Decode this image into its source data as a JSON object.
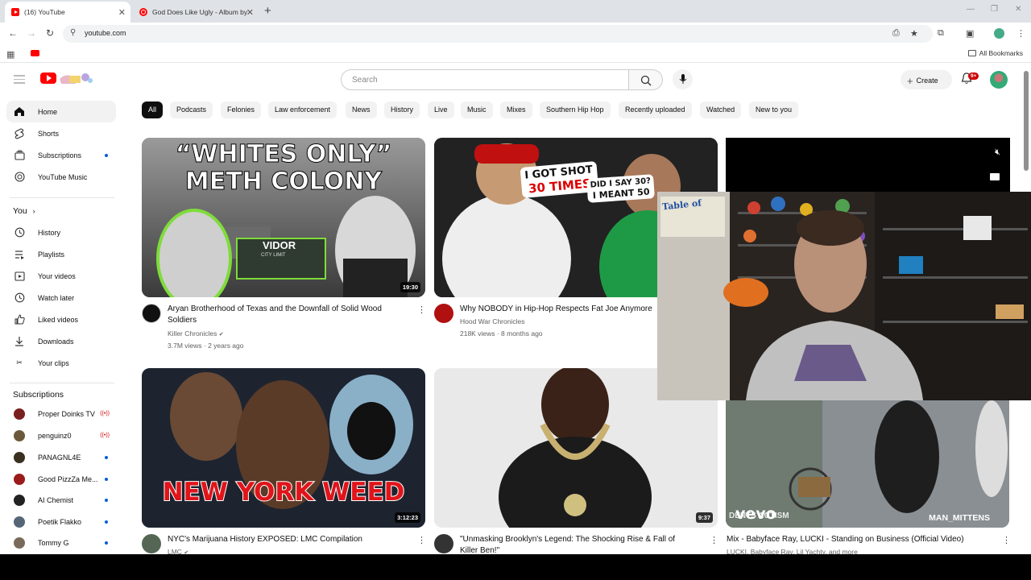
{
  "browser": {
    "tabs": [
      {
        "title": "(16) YouTube",
        "active": true
      },
      {
        "title": "God Does Like Ugly - Album by",
        "active": false
      }
    ],
    "url": "youtube.com",
    "all_bookmarks": "All Bookmarks"
  },
  "masthead": {
    "search_placeholder": "Search",
    "create_label": "Create",
    "notification_count": "9+"
  },
  "sidebar": {
    "main": [
      {
        "label": "Home",
        "icon": "home-icon",
        "active": true
      },
      {
        "label": "Shorts",
        "icon": "shorts-icon"
      },
      {
        "label": "Subscriptions",
        "icon": "subscriptions-icon",
        "dot": true
      },
      {
        "label": "YouTube Music",
        "icon": "music-icon"
      }
    ],
    "you_title": "You",
    "you": [
      {
        "label": "History",
        "icon": "history-icon"
      },
      {
        "label": "Playlists",
        "icon": "playlists-icon"
      },
      {
        "label": "Your videos",
        "icon": "your-videos-icon"
      },
      {
        "label": "Watch later",
        "icon": "watch-later-icon"
      },
      {
        "label": "Liked videos",
        "icon": "like-icon"
      },
      {
        "label": "Downloads",
        "icon": "download-icon"
      },
      {
        "label": "Your clips",
        "icon": "scissors-icon"
      }
    ],
    "subs_title": "Subscriptions",
    "subscriptions": [
      {
        "label": "Proper Doinks TV",
        "status": "live",
        "color": "#7a1f1f"
      },
      {
        "label": "penguinz0",
        "status": "live",
        "color": "#6b5a3a"
      },
      {
        "label": "PANAGNL4E",
        "status": "dot",
        "color": "#3a3020"
      },
      {
        "label": "Good PizzZa Me...",
        "status": "dot",
        "color": "#9b1b1b"
      },
      {
        "label": "AI Chemist",
        "status": "dot",
        "color": "#222222"
      },
      {
        "label": "Poetik Flakko",
        "status": "dot",
        "color": "#556677"
      },
      {
        "label": "Tommy G",
        "status": "dot",
        "color": "#7a6a5a"
      }
    ]
  },
  "chips": [
    "All",
    "Podcasts",
    "Felonies",
    "Law enforcement",
    "News",
    "History",
    "Live",
    "Music",
    "Mixes",
    "Southern Hip Hop",
    "Recently uploaded",
    "Watched",
    "New to you"
  ],
  "videos": [
    {
      "title_l1": "Aryan Brotherhood of Texas and the Downfall of Solid Wood",
      "title_l2": "Soldiers",
      "channel": "Killer Chronicles",
      "meta": "3.7M views · 2 years ago",
      "duration": "19:30",
      "thumb_text_1": "“WHITES ONLY”",
      "thumb_text_2": "METH COLONY",
      "sign_text": "VIDOR",
      "sign_sub": "CITY LIMIT"
    },
    {
      "title_l1": "Why NOBODY in Hip-Hop Respects Fat Joe Anymore",
      "title_l2": "",
      "channel": "Hood War Chronicles",
      "meta": "218K views · 8 months ago",
      "duration": "",
      "bubble_1a": "I GOT SHOT",
      "bubble_1b": "30 TIMES",
      "bubble_2a": "DID I SAY 30?",
      "bubble_2b": "I MEANT 50"
    },
    {
      "title_l1": "NYC's Marijuana History EXPOSED: LMC Compilation",
      "title_l2": "",
      "channel": "LMC",
      "meta": "",
      "duration": "3:12:23",
      "thumb_text_1": "NEW YORK WEED"
    },
    {
      "title_l1": "\"Unmasking Brooklyn's Legend: The Shocking Rise & Fall of",
      "title_l2": "Killer Ben!\"",
      "channel": "",
      "meta": "",
      "duration": "9:37"
    },
    {
      "title_l1": "Mix - Babyface Ray, LUCKI - Standing on Business (Official Video)",
      "title_l2": "",
      "channel": "LUCKI, Babyface Ray, Lil Yachty, and more",
      "meta": "",
      "duration": "",
      "thumb_text_1": "vevo",
      "thumb_text_2": "MAN_MITTENS",
      "thumb_text_3": "DENTS ACTISM"
    }
  ],
  "webcam_sign": "Table of"
}
